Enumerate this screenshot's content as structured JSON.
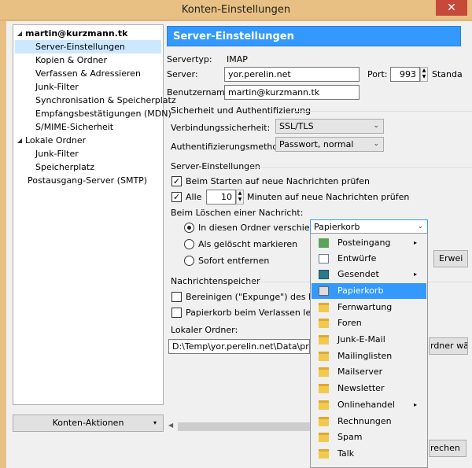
{
  "window": {
    "title": "Konten-Einstellungen",
    "close_glyph": "✕"
  },
  "sidebar": {
    "items": [
      {
        "label": "martin@kurzmann.tk",
        "toggle": "◢",
        "bold": true
      },
      {
        "label": "Server-Einstellungen",
        "selected": true
      },
      {
        "label": "Kopien & Ordner"
      },
      {
        "label": "Verfassen & Adressieren"
      },
      {
        "label": "Junk-Filter"
      },
      {
        "label": "Synchronisation & Speicherplatz"
      },
      {
        "label": "Empfangsbestätigungen (MDN)"
      },
      {
        "label": "S/MIME-Sicherheit"
      },
      {
        "label": "Lokale Ordner",
        "toggle": "◢"
      },
      {
        "label": "Junk-Filter"
      },
      {
        "label": "Speicherplatz"
      },
      {
        "label": "Postausgang-Server (SMTP)"
      }
    ],
    "actions_label": "Konten-Aktionen",
    "actions_arrow": "▾"
  },
  "main": {
    "header": "Server-Einstellungen",
    "servertyp_label": "Servertyp:",
    "servertyp_value": "IMAP",
    "server_label": "Server:",
    "server_value": "yor.perelin.net",
    "port_label": "Port:",
    "port_value": "993",
    "standard_label": "Standa",
    "username_label": "Benutzername:",
    "username_value": "martin@kurzmann.tk",
    "security": {
      "title": "Sicherheit und Authentifizierung",
      "conn_label": "Verbindungssicherheit:",
      "conn_value": "SSL/TLS",
      "auth_label": "Authentifizierungsmethode:",
      "auth_value": "Passwort, normal"
    },
    "server_settings": {
      "title": "Server-Einstellungen",
      "check_start": "Beim Starten auf neue Nachrichten prüfen",
      "check_every_label": "Alle",
      "check_every_value": "10",
      "check_every_suffix": "Minuten auf neue Nachrichten prüfen",
      "delete_label": "Beim Löschen einer Nachricht:",
      "opt_move": "In diesen Ordner verschieben:",
      "opt_move_value": "Papierkorb",
      "opt_mark": "Als gelöscht markieren",
      "opt_remove": "Sofort entfernen",
      "advanced_btn": "Erwei"
    },
    "storage": {
      "title": "Nachrichtenspeicher",
      "expunge": "Bereinigen (\"Expunge\") des Posteing",
      "empty_trash": "Papierkorb beim Verlassen leeren",
      "local_folder_label": "Lokaler Ordner:",
      "local_folder_value": "D:\\Temp\\yor.perelin.net\\Data\\profile\\I",
      "choose_btn": "rdner wäh",
      "cancel_btn": "rechen"
    }
  },
  "dropdown": {
    "items": [
      {
        "label": "Posteingang",
        "icon": "inbox-icon",
        "sub": true
      },
      {
        "label": "Entwürfe",
        "icon": "drafts-icon"
      },
      {
        "label": "Gesendet",
        "icon": "sent-icon",
        "sub": true
      },
      {
        "label": "Papierkorb",
        "icon": "trash-icon",
        "highlight": true
      },
      {
        "label": "Fernwartung",
        "icon": "folder-icon"
      },
      {
        "label": "Foren",
        "icon": "folder-icon"
      },
      {
        "label": "Junk-E-Mail",
        "icon": "folder-icon"
      },
      {
        "label": "Mailinglisten",
        "icon": "folder-icon"
      },
      {
        "label": "Mailserver",
        "icon": "folder-icon"
      },
      {
        "label": "Newsletter",
        "icon": "folder-icon"
      },
      {
        "label": "Onlinehandel",
        "icon": "folder-icon",
        "sub": true
      },
      {
        "label": "Rechnungen",
        "icon": "folder-icon"
      },
      {
        "label": "Spam",
        "icon": "folder-icon"
      },
      {
        "label": "Talk",
        "icon": "folder-icon"
      }
    ],
    "sub_glyph": "▸"
  }
}
